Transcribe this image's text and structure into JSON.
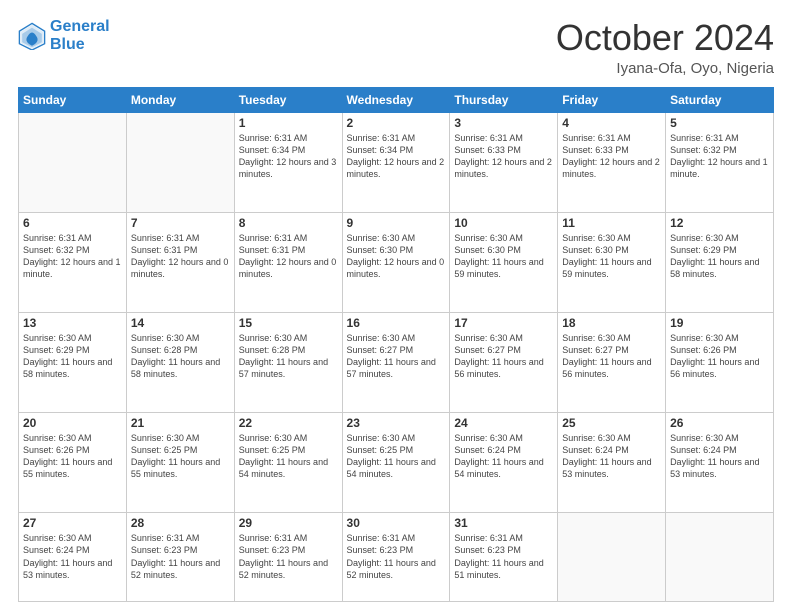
{
  "header": {
    "logo_line1": "General",
    "logo_line2": "Blue",
    "month": "October 2024",
    "location": "Iyana-Ofa, Oyo, Nigeria"
  },
  "days_of_week": [
    "Sunday",
    "Monday",
    "Tuesday",
    "Wednesday",
    "Thursday",
    "Friday",
    "Saturday"
  ],
  "weeks": [
    [
      {
        "day": "",
        "info": ""
      },
      {
        "day": "",
        "info": ""
      },
      {
        "day": "1",
        "info": "Sunrise: 6:31 AM\nSunset: 6:34 PM\nDaylight: 12 hours and 3 minutes."
      },
      {
        "day": "2",
        "info": "Sunrise: 6:31 AM\nSunset: 6:34 PM\nDaylight: 12 hours and 2 minutes."
      },
      {
        "day": "3",
        "info": "Sunrise: 6:31 AM\nSunset: 6:33 PM\nDaylight: 12 hours and 2 minutes."
      },
      {
        "day": "4",
        "info": "Sunrise: 6:31 AM\nSunset: 6:33 PM\nDaylight: 12 hours and 2 minutes."
      },
      {
        "day": "5",
        "info": "Sunrise: 6:31 AM\nSunset: 6:32 PM\nDaylight: 12 hours and 1 minute."
      }
    ],
    [
      {
        "day": "6",
        "info": "Sunrise: 6:31 AM\nSunset: 6:32 PM\nDaylight: 12 hours and 1 minute."
      },
      {
        "day": "7",
        "info": "Sunrise: 6:31 AM\nSunset: 6:31 PM\nDaylight: 12 hours and 0 minutes."
      },
      {
        "day": "8",
        "info": "Sunrise: 6:31 AM\nSunset: 6:31 PM\nDaylight: 12 hours and 0 minutes."
      },
      {
        "day": "9",
        "info": "Sunrise: 6:30 AM\nSunset: 6:30 PM\nDaylight: 12 hours and 0 minutes."
      },
      {
        "day": "10",
        "info": "Sunrise: 6:30 AM\nSunset: 6:30 PM\nDaylight: 11 hours and 59 minutes."
      },
      {
        "day": "11",
        "info": "Sunrise: 6:30 AM\nSunset: 6:30 PM\nDaylight: 11 hours and 59 minutes."
      },
      {
        "day": "12",
        "info": "Sunrise: 6:30 AM\nSunset: 6:29 PM\nDaylight: 11 hours and 58 minutes."
      }
    ],
    [
      {
        "day": "13",
        "info": "Sunrise: 6:30 AM\nSunset: 6:29 PM\nDaylight: 11 hours and 58 minutes."
      },
      {
        "day": "14",
        "info": "Sunrise: 6:30 AM\nSunset: 6:28 PM\nDaylight: 11 hours and 58 minutes."
      },
      {
        "day": "15",
        "info": "Sunrise: 6:30 AM\nSunset: 6:28 PM\nDaylight: 11 hours and 57 minutes."
      },
      {
        "day": "16",
        "info": "Sunrise: 6:30 AM\nSunset: 6:27 PM\nDaylight: 11 hours and 57 minutes."
      },
      {
        "day": "17",
        "info": "Sunrise: 6:30 AM\nSunset: 6:27 PM\nDaylight: 11 hours and 56 minutes."
      },
      {
        "day": "18",
        "info": "Sunrise: 6:30 AM\nSunset: 6:27 PM\nDaylight: 11 hours and 56 minutes."
      },
      {
        "day": "19",
        "info": "Sunrise: 6:30 AM\nSunset: 6:26 PM\nDaylight: 11 hours and 56 minutes."
      }
    ],
    [
      {
        "day": "20",
        "info": "Sunrise: 6:30 AM\nSunset: 6:26 PM\nDaylight: 11 hours and 55 minutes."
      },
      {
        "day": "21",
        "info": "Sunrise: 6:30 AM\nSunset: 6:25 PM\nDaylight: 11 hours and 55 minutes."
      },
      {
        "day": "22",
        "info": "Sunrise: 6:30 AM\nSunset: 6:25 PM\nDaylight: 11 hours and 54 minutes."
      },
      {
        "day": "23",
        "info": "Sunrise: 6:30 AM\nSunset: 6:25 PM\nDaylight: 11 hours and 54 minutes."
      },
      {
        "day": "24",
        "info": "Sunrise: 6:30 AM\nSunset: 6:24 PM\nDaylight: 11 hours and 54 minutes."
      },
      {
        "day": "25",
        "info": "Sunrise: 6:30 AM\nSunset: 6:24 PM\nDaylight: 11 hours and 53 minutes."
      },
      {
        "day": "26",
        "info": "Sunrise: 6:30 AM\nSunset: 6:24 PM\nDaylight: 11 hours and 53 minutes."
      }
    ],
    [
      {
        "day": "27",
        "info": "Sunrise: 6:30 AM\nSunset: 6:24 PM\nDaylight: 11 hours and 53 minutes."
      },
      {
        "day": "28",
        "info": "Sunrise: 6:31 AM\nSunset: 6:23 PM\nDaylight: 11 hours and 52 minutes."
      },
      {
        "day": "29",
        "info": "Sunrise: 6:31 AM\nSunset: 6:23 PM\nDaylight: 11 hours and 52 minutes."
      },
      {
        "day": "30",
        "info": "Sunrise: 6:31 AM\nSunset: 6:23 PM\nDaylight: 11 hours and 52 minutes."
      },
      {
        "day": "31",
        "info": "Sunrise: 6:31 AM\nSunset: 6:23 PM\nDaylight: 11 hours and 51 minutes."
      },
      {
        "day": "",
        "info": ""
      },
      {
        "day": "",
        "info": ""
      }
    ]
  ]
}
